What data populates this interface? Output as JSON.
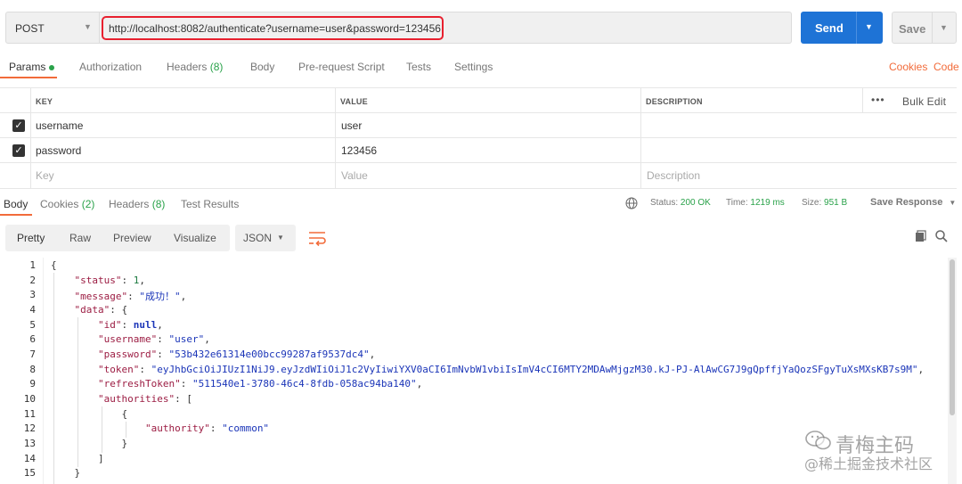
{
  "request": {
    "method": "POST",
    "url": "http://localhost:8082/authenticate?username=user&password=123456",
    "send_label": "Send",
    "save_label": "Save"
  },
  "request_tabs": {
    "params": "Params",
    "authorization": "Authorization",
    "headers": "Headers",
    "headers_count": "(8)",
    "body": "Body",
    "prerequest": "Pre-request Script",
    "tests": "Tests",
    "settings": "Settings",
    "cookies": "Cookies",
    "code": "Code"
  },
  "params_table": {
    "headers": {
      "key": "KEY",
      "value": "VALUE",
      "description": "DESCRIPTION",
      "more": "•••",
      "bulk_edit": "Bulk Edit"
    },
    "rows": [
      {
        "key": "username",
        "value": "user",
        "checked": true
      },
      {
        "key": "password",
        "value": "123456",
        "checked": true
      }
    ],
    "placeholder": {
      "key": "Key",
      "value": "Value",
      "description": "Description"
    }
  },
  "response_tabs": {
    "body": "Body",
    "cookies": "Cookies",
    "cookies_count": "(2)",
    "headers": "Headers",
    "headers_count": "(8)",
    "test_results": "Test Results"
  },
  "response_status": {
    "status_label": "Status:",
    "status_value": "200 OK",
    "time_label": "Time:",
    "time_value": "1219 ms",
    "size_label": "Size:",
    "size_value": "951 B",
    "save_response": "Save Response"
  },
  "response_toolbar": {
    "pretty": "Pretty",
    "raw": "Raw",
    "preview": "Preview",
    "visualize": "Visualize",
    "format": "JSON"
  },
  "code": {
    "line_numbers": [
      "1",
      "2",
      "3",
      "4",
      "5",
      "6",
      "7",
      "8",
      "9",
      "10",
      "11",
      "12",
      "13",
      "14",
      "15"
    ],
    "l1": "{",
    "status_key": "\"status\"",
    "status_val": "1",
    "message_key": "\"message\"",
    "message_val": "\"成功！\"",
    "data_key": "\"data\"",
    "id_key": "\"id\"",
    "id_val": "null",
    "username_key": "\"username\"",
    "username_val": "\"user\"",
    "password_key": "\"password\"",
    "password_val": "\"53b432e61314e00bcc99287af9537dc4\"",
    "token_key": "\"token\"",
    "token_val": "\"eyJhbGciOiJIUzI1NiJ9.eyJzdWIiOiJ1c2VyIiwiYXV0aCI6ImNvbW1vbiIsImV4cCI6MTY2MDAwMjgzM30.kJ-PJ-AlAwCG7J9gQpffjYaQozSFgyTuXsMXsKB7s9M\"",
    "refresh_key": "\"refreshToken\"",
    "refresh_val": "\"511540e1-3780-46c4-8fdb-058ac94ba140\"",
    "authorities_key": "\"authorities\"",
    "authority_key": "\"authority\"",
    "authority_val": "\"common\""
  },
  "watermark": {
    "line1": "青梅主码",
    "line2": "@稀土掘金技术社区"
  }
}
